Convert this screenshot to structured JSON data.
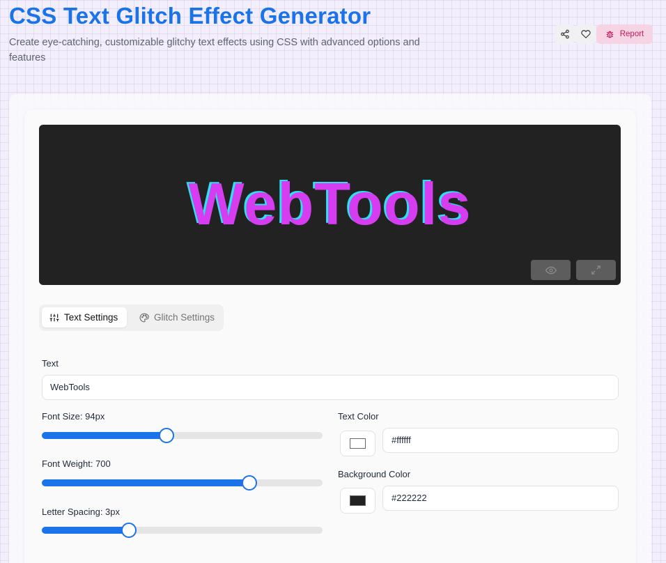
{
  "header": {
    "title": "CSS Text Glitch Effect Generator",
    "subtitle": "Create eye-catching, customizable glitchy text effects using CSS with advanced options and features",
    "share_icon": "share-icon",
    "favorite_icon": "heart-icon",
    "report_label": "Report",
    "report_icon": "bug-icon"
  },
  "preview": {
    "text": "WebTools",
    "background": "#222222",
    "main_color": "#d63cf0",
    "cyan_color": "#2ce0ee",
    "controls": [
      {
        "icon": "eye-icon"
      },
      {
        "icon": "expand-icon"
      }
    ]
  },
  "tabs": [
    {
      "label": "Text Settings",
      "icon": "sliders-icon",
      "active": true
    },
    {
      "label": "Glitch Settings",
      "icon": "palette-icon",
      "active": false
    }
  ],
  "settings": {
    "text_label": "Text",
    "text_value": "WebTools",
    "font_size_label": "Font Size: 94px",
    "font_size_fraction": 0.445,
    "font_weight_label": "Font Weight: 700",
    "font_weight_fraction": 0.74,
    "letter_spacing_label": "Letter Spacing: 3px",
    "letter_spacing_fraction": 0.31,
    "text_color_label": "Text Color",
    "text_color_value": "#ffffff",
    "bg_color_label": "Background Color",
    "bg_color_value": "#222222"
  },
  "colors": {
    "accent": "#1a73e8",
    "report_bg": "#f6d4e4",
    "report_text": "#c2185b"
  }
}
